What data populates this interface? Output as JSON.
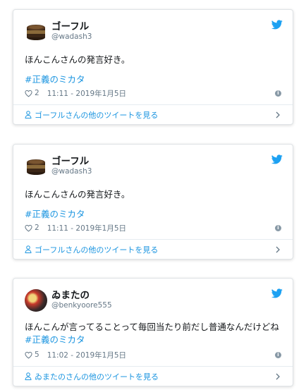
{
  "tweets": [
    {
      "display_name": "ゴーフル",
      "handle": "@wadash3",
      "text": "ほんこんさんの発言好き。",
      "hashtag": "#正義のミカタ",
      "likes": "2",
      "timestamp": "11:11 - 2019年1月5日",
      "footer": "ゴーフルさんの他のツイートを見る",
      "avatar_icon": "food-tin-icon"
    },
    {
      "display_name": "ゴーフル",
      "handle": "@wadash3",
      "text": "ほんこんさんの発言好き。",
      "hashtag": "#正義のミカタ",
      "likes": "2",
      "timestamp": "11:11 - 2019年1月5日",
      "footer": "ゴーフルさんの他のツイートを見る",
      "avatar_icon": "food-tin-icon"
    },
    {
      "display_name": "ゐまたの",
      "handle": "@benkyoore555",
      "text": "ほんこんが言ってることって毎回当たり前だし普通なんだけどね",
      "hashtag": "#正義のミカタ",
      "likes": "5",
      "timestamp": "11:02 - 2019年1月5日",
      "footer": "ゐまたのさんの他のツイートを見る",
      "avatar_icon": "user-photo"
    }
  ],
  "colors": {
    "link": "#1b95e0",
    "secondary_text": "#657786",
    "border": "#dfe3e6"
  }
}
